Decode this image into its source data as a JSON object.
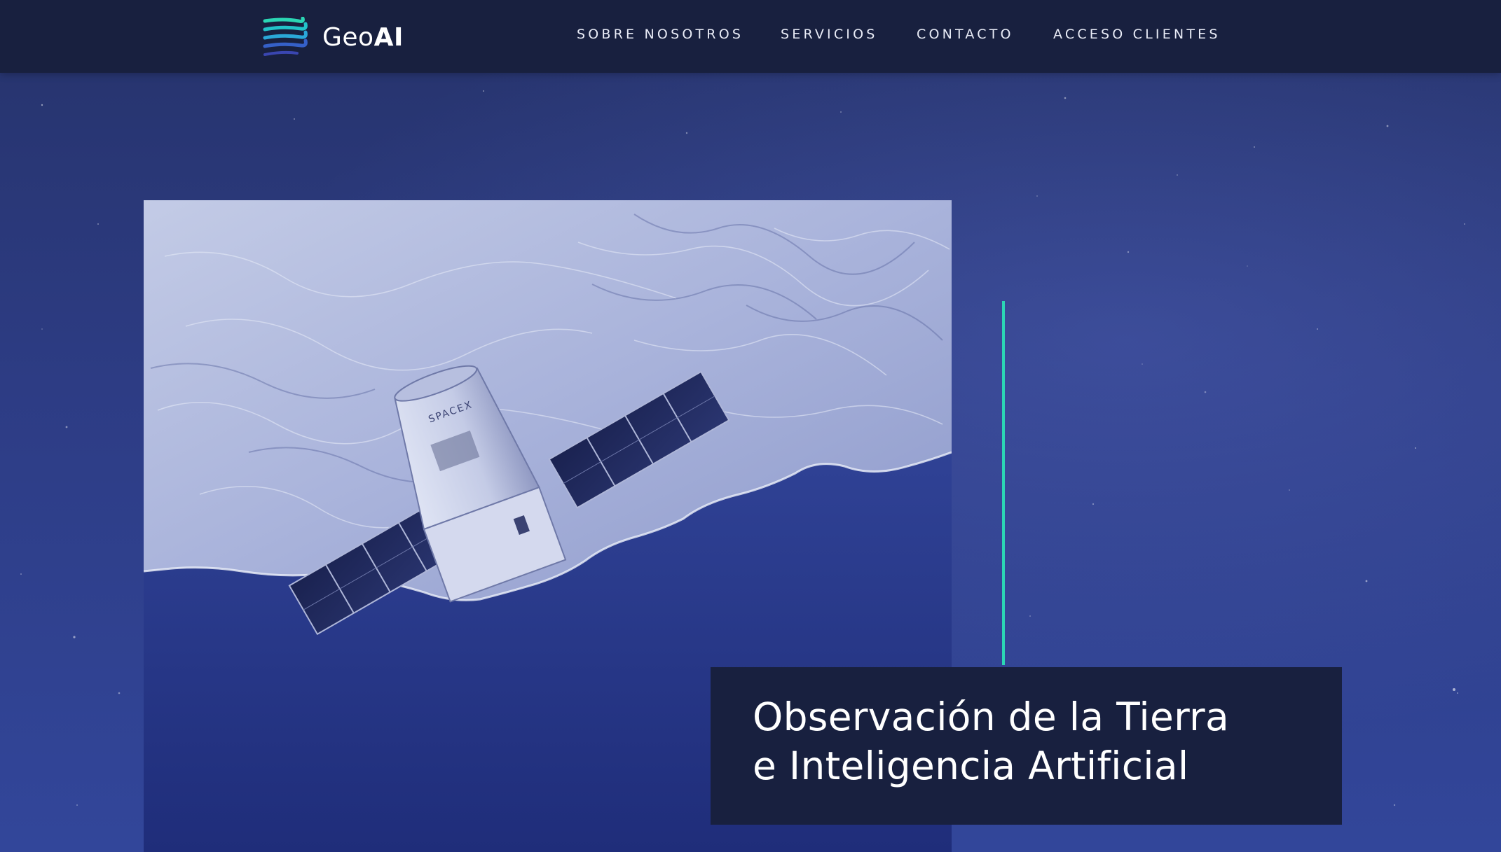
{
  "brand": {
    "name_regular": "Geo",
    "name_bold": "AI",
    "logo_icon": "layered-waves-logo",
    "colors": {
      "accent": "#2bd6b4",
      "header_bg": "#18203f",
      "page_bg": "#2d3c84",
      "text": "#ffffff"
    }
  },
  "nav": {
    "items": [
      {
        "label": "SOBRE NOSOTROS"
      },
      {
        "label": "SERVICIOS"
      },
      {
        "label": "CONTACTO"
      },
      {
        "label": "ACCESO CLIENTES"
      }
    ]
  },
  "hero": {
    "image_subject": "satellite-over-coastline",
    "satellite_marking": "SPACEX",
    "title_line1": "Observación de la Tierra",
    "title_line2": "e Inteligencia Artificial"
  }
}
